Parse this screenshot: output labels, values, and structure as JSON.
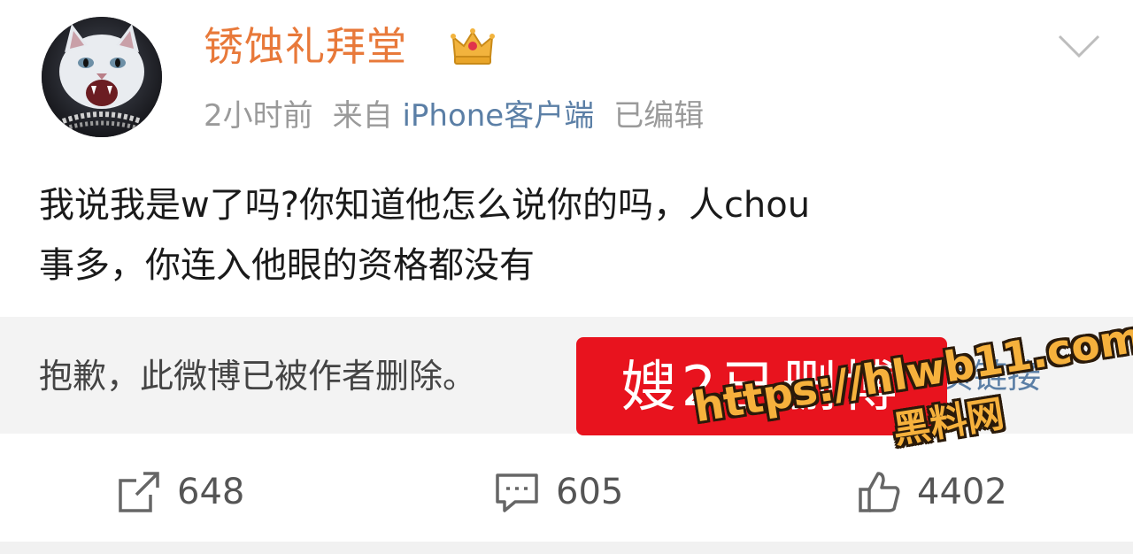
{
  "post": {
    "author": {
      "username": "锈蚀礼拜堂",
      "avatar_icon": "white-cat-avatar-icon",
      "badge_icon": "crown-icon"
    },
    "meta": {
      "time": "2小时前",
      "source_prefix": "来自",
      "source": "iPhone客户端",
      "edited": "已编辑"
    },
    "text_line1": "我说我是w了吗?你知道他怎么说你的吗，人chou",
    "text_line2": "事多，你连入他眼的资格都没有",
    "retweet": {
      "deleted_notice": "抱歉，此微博已被作者删除。",
      "link_text_partial": "页链接"
    },
    "overlay_label": "嫂2已删博",
    "actions": {
      "repost_icon": "repost-icon",
      "repost_count": "648",
      "comment_icon": "comment-icon",
      "comment_count": "605",
      "like_icon": "like-icon",
      "like_count": "4402"
    },
    "watermark": {
      "url": "https://hlwb11.com",
      "name": "黑料网"
    }
  },
  "colors": {
    "username": "#e8793a",
    "link": "#5b7fa6",
    "stamp_red": "#e8131e",
    "watermark_fill": "#f6b13c"
  }
}
